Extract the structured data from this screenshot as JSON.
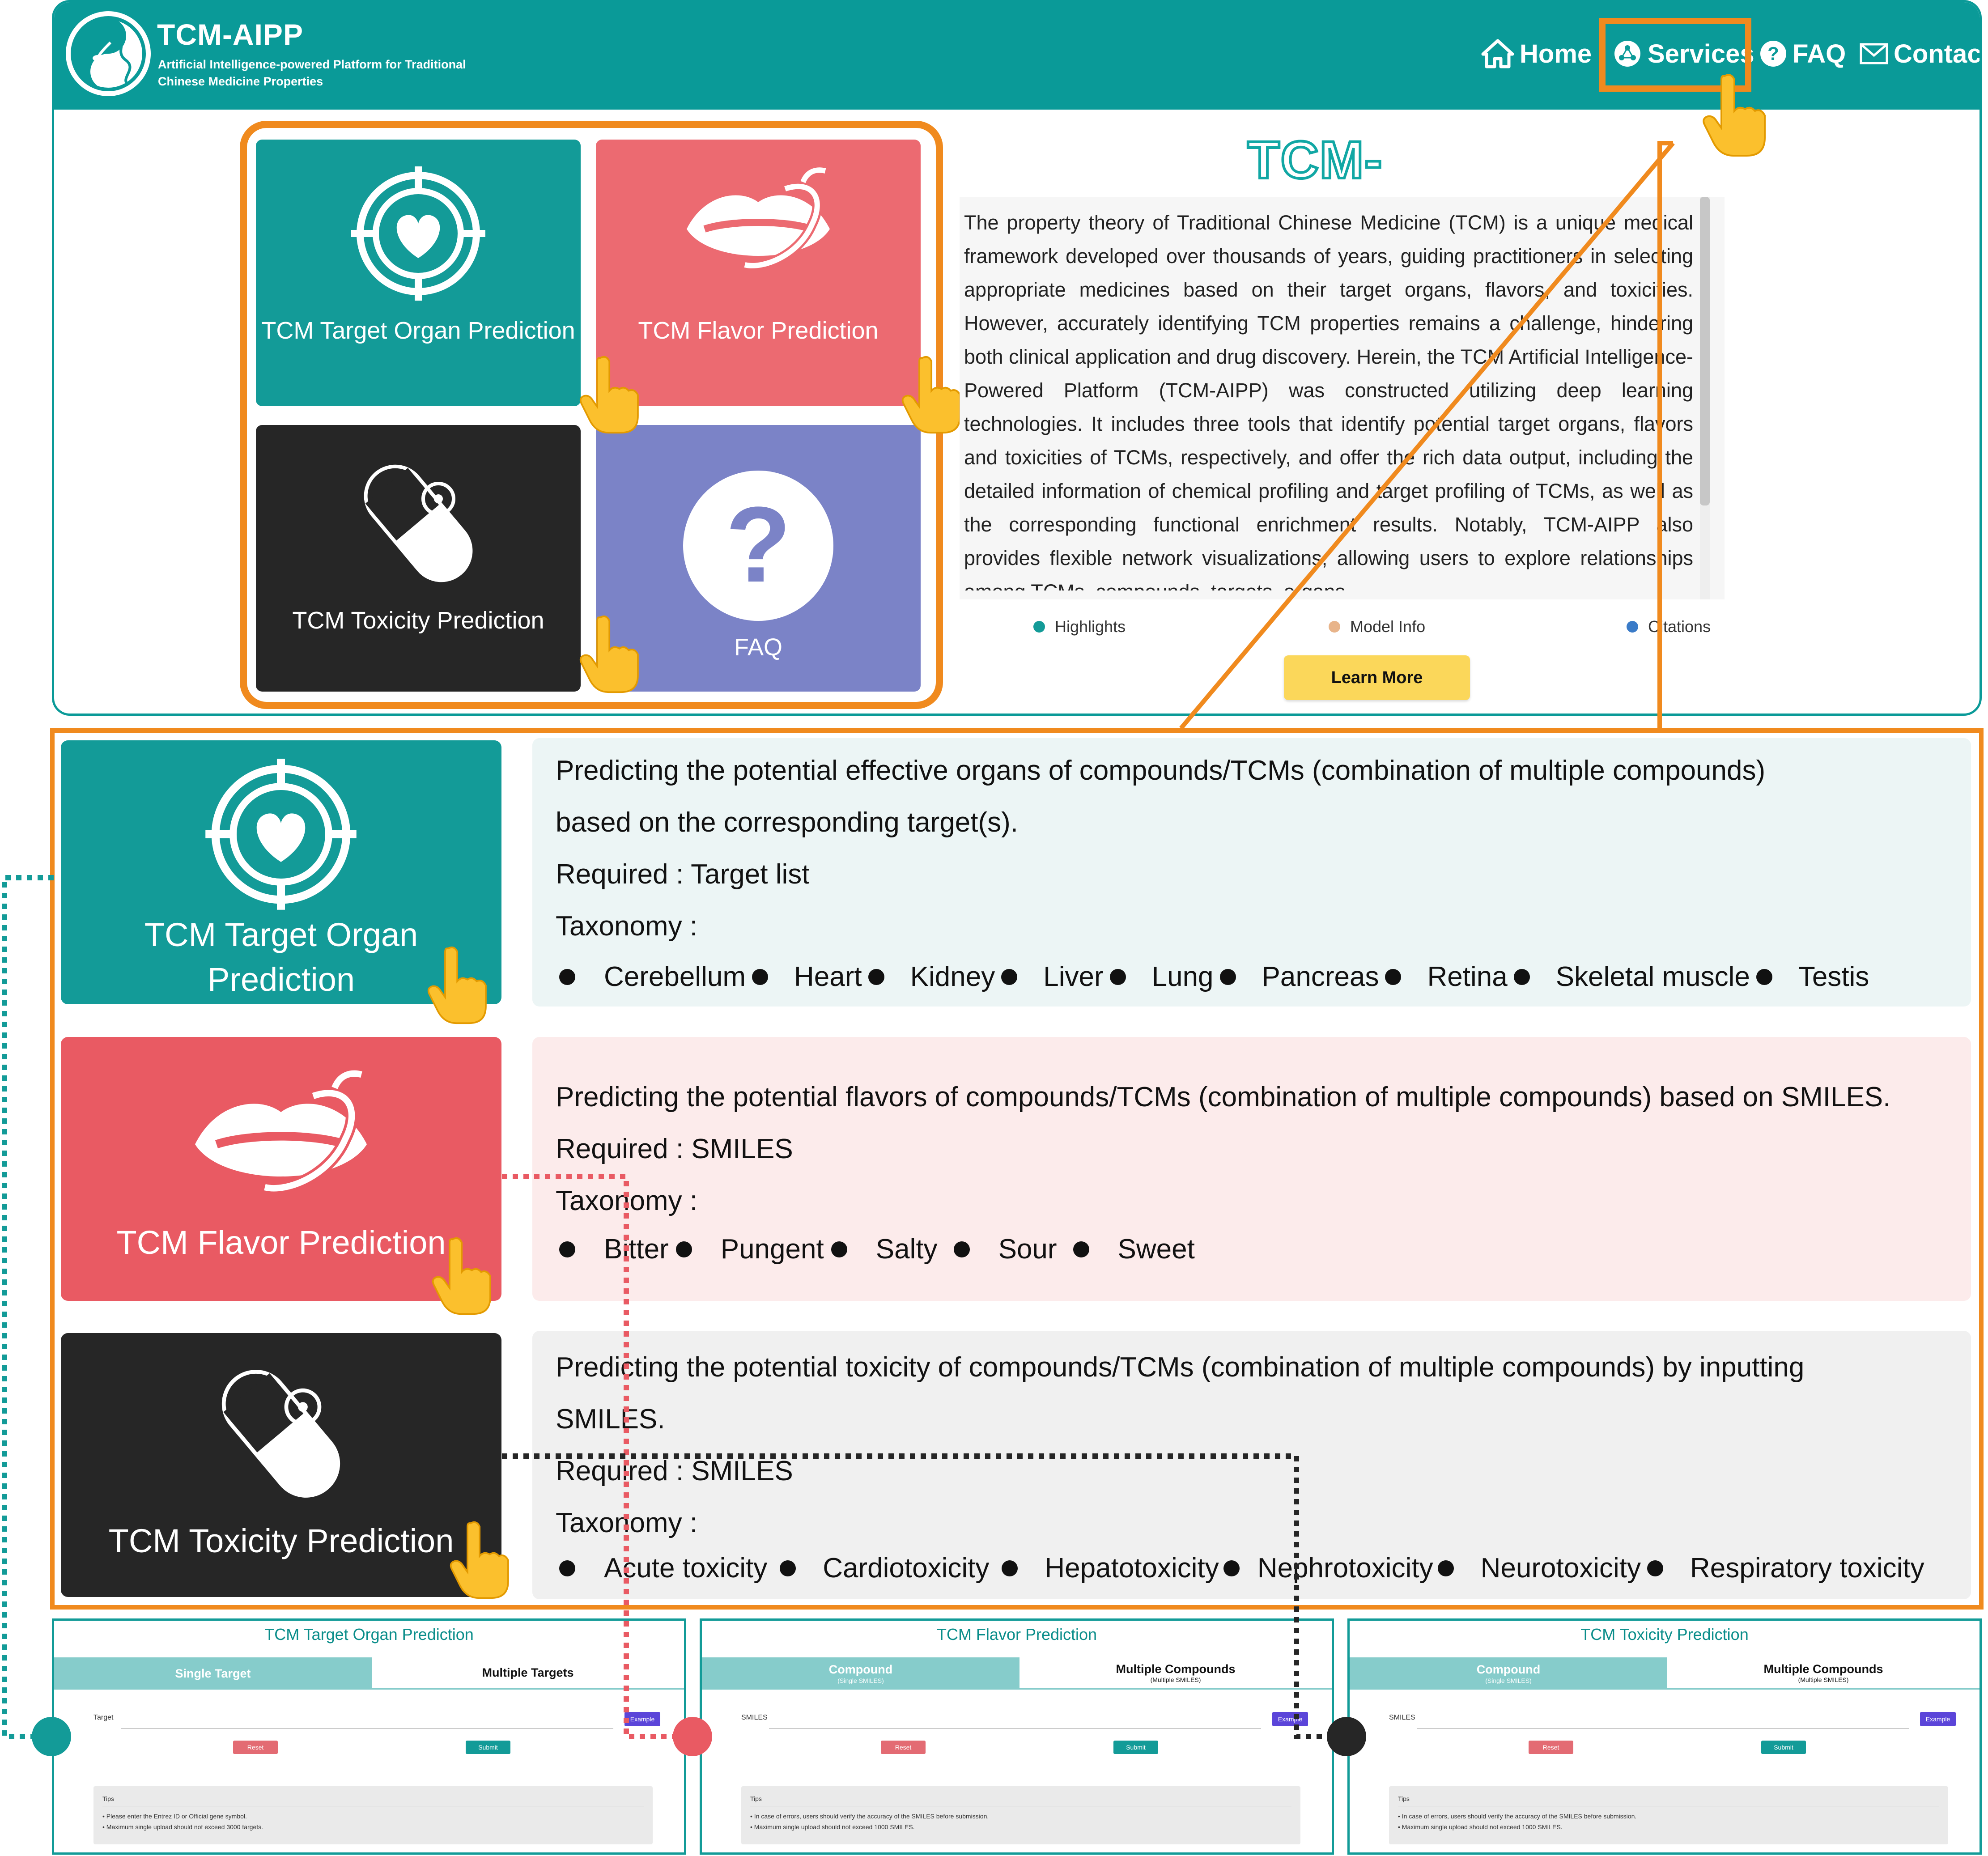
{
  "header": {
    "brand": "TCM-AIPP",
    "brand_subtitle": "Artificial Intelligence-powered Platform for Traditional Chinese Medicine Properties",
    "nav": {
      "home": "Home",
      "services": "Services",
      "faq": "FAQ",
      "contact": "Contact"
    },
    "accent": "#0a9a98"
  },
  "tiles": {
    "organ": "TCM Target Organ Prediction",
    "flavor": "TCM Flavor Prediction",
    "toxicity": "TCM Toxicity Prediction",
    "faq": "FAQ"
  },
  "about": {
    "title": "TCM-AIPP",
    "text": "The property theory of Traditional Chinese Medicine (TCM) is a unique medical framework developed over thousands of years, guiding practitioners in selecting appropriate medicines based on their target organs, flavors, and toxicities. However, accurately identifying TCM properties remains a challenge, hindering both clinical application and drug discovery. Herein, the TCM Artificial Intelligence-Powered Platform (TCM-AIPP) was constructed utilizing deep learning technologies. It includes three tools that identify potential target organs, flavors and toxicities of TCMs, respectively, and offer the rich data output, including the detailed information of chemical profiling and target profiling of TCMs, as well as the corresponding functional enrichment results. Notably, TCM-AIPP also provides flexible network visualizations, allowing users to explore relationships among TCMs, compounds, targets, organs,",
    "legend": [
      "Highlights",
      "Model Info",
      "Citations"
    ],
    "legend_colors": [
      "#139b98",
      "#e8b48a",
      "#3a7bc8"
    ],
    "learn_more": "Learn More"
  },
  "details": {
    "organ": {
      "card": "TCM Target Organ Prediction",
      "line1": "Predicting the potential effective organs of compounds/TCMs (combination of multiple compounds)",
      "line2": "based on the corresponding target(s).",
      "required": "Required : Target list",
      "taxonomy": "Taxonomy :",
      "items": [
        "Cerebellum",
        "Heart",
        "Kidney",
        "Liver",
        "Lung",
        "Pancreas",
        "Retina",
        "Skeletal muscle",
        "Testis"
      ]
    },
    "flavor": {
      "card": "TCM Flavor Prediction",
      "line1": "Predicting the potential flavors of compounds/TCMs (combination of multiple compounds) based on SMILES.",
      "required": "Required : SMILES",
      "taxonomy": "Taxonomy :",
      "items": [
        "Bitter",
        "Pungent",
        "Salty",
        "Sour",
        "Sweet"
      ]
    },
    "toxicity": {
      "card": "TCM Toxicity Prediction",
      "line1": "Predicting the potential toxicity of compounds/TCMs (combination of multiple compounds) by inputting",
      "line2": "SMILES.",
      "required": "Required : SMILES",
      "taxonomy": "Taxonomy :",
      "items": [
        "Acute toxicity",
        "Cardiotoxicity",
        "Hepatotoxicity",
        "Nephrotoxicity",
        "Neurotoxicity",
        "Respiratory toxicity"
      ]
    }
  },
  "forms": [
    {
      "title": "TCM Target Organ Prediction",
      "tab1": "Single Target",
      "tab1_sub": "",
      "tab2": "Multiple Targets",
      "tab2_sub": "",
      "field_label": "Target",
      "example": "Example",
      "reset": "Reset",
      "submit": "Submit",
      "tips_title": "Tips",
      "tip1": "Please enter the Entrez ID or Official gene symbol.",
      "tip2": "Maximum single upload should not exceed 3000 targets."
    },
    {
      "title": "TCM Flavor Prediction",
      "tab1": "Compound",
      "tab1_sub": "(Single SMILES)",
      "tab2": "Multiple Compounds",
      "tab2_sub": "(Multiple SMILES)",
      "field_label": "SMILES",
      "example": "Example",
      "reset": "Reset",
      "submit": "Submit",
      "tips_title": "Tips",
      "tip1": "In case of errors, users should verify the accuracy of the SMILES before submission.",
      "tip2": "Maximum single upload should not exceed 1000 SMILES."
    },
    {
      "title": "TCM Toxicity Prediction",
      "tab1": "Compound",
      "tab1_sub": "(Single SMILES)",
      "tab2": "Multiple Compounds",
      "tab2_sub": "(Multiple SMILES)",
      "field_label": "SMILES",
      "example": "Example",
      "reset": "Reset",
      "submit": "Submit",
      "tips_title": "Tips",
      "tip1": "In case of errors, users should verify the accuracy of the SMILES before submission.",
      "tip2": "Maximum single upload should not exceed 1000 SMILES."
    }
  ],
  "colors": {
    "highlight_orange": "#f08a1e",
    "teal": "#139b98",
    "flavor_red": "#e95a63",
    "toxicity_dark": "#262626",
    "faq_purple": "#7b83c7"
  }
}
